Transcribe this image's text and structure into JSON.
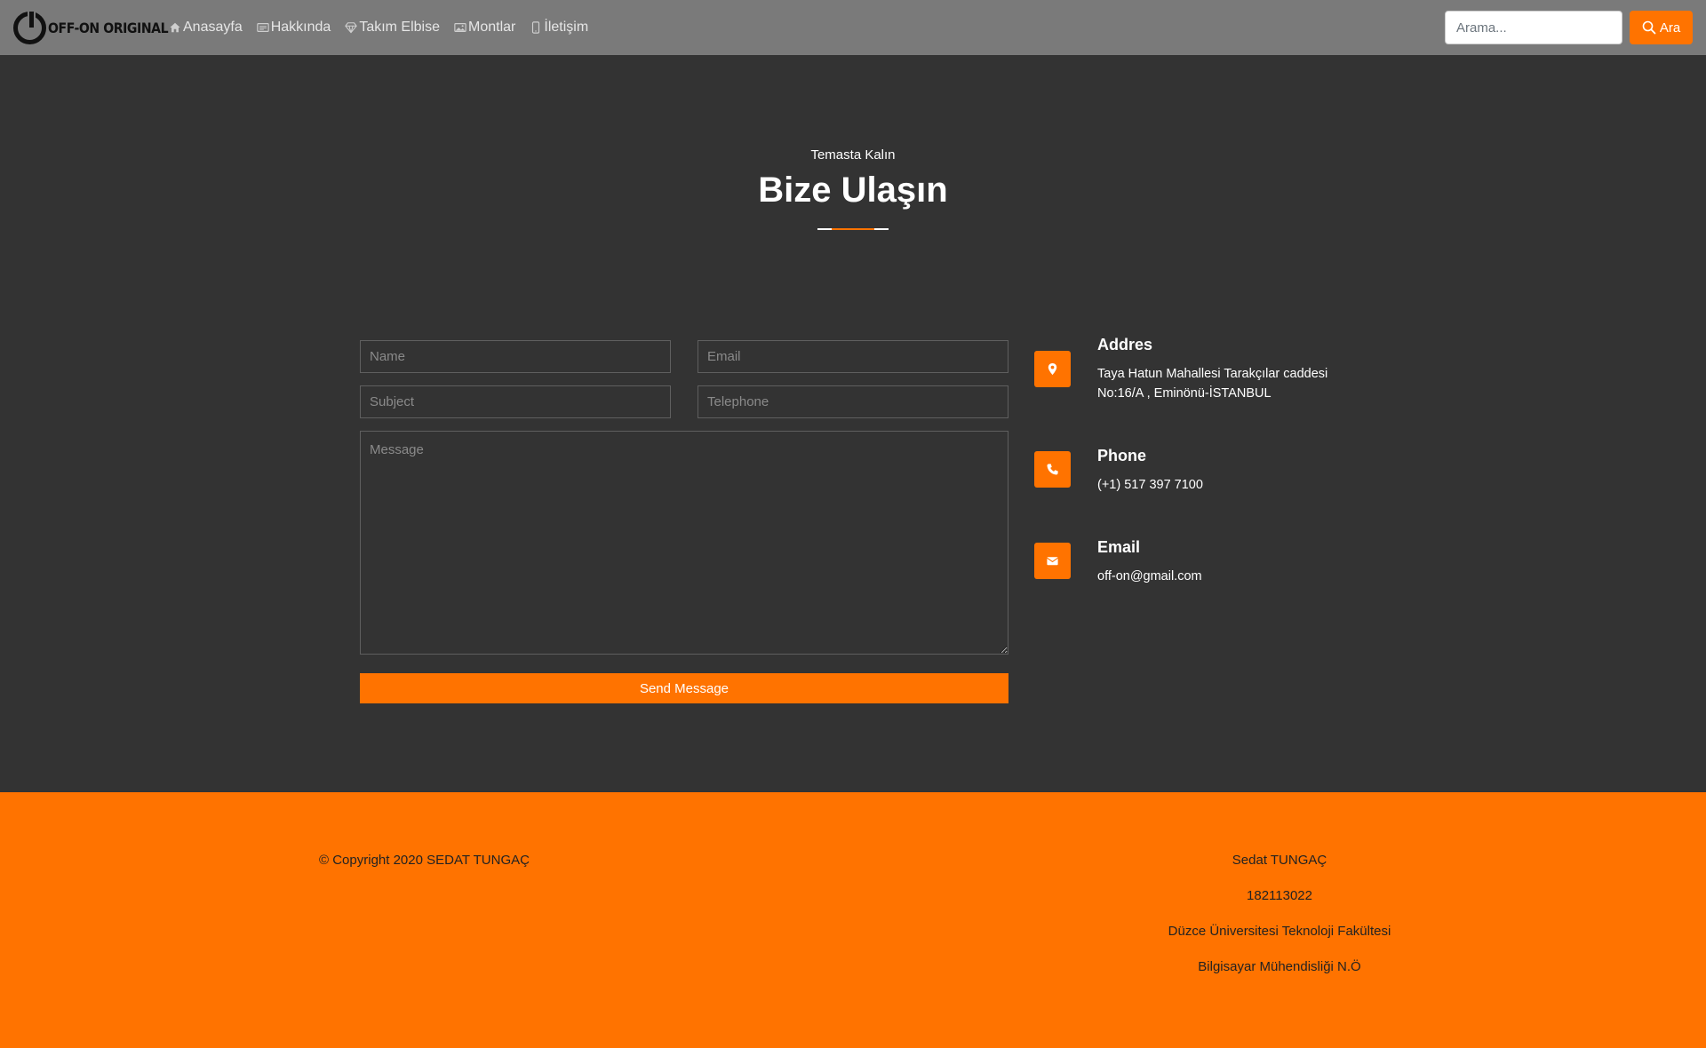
{
  "navbar": {
    "brand_text": "OFF-ON ORIGINAL",
    "items": [
      {
        "label": "Anasayfa",
        "icon": "home-icon"
      },
      {
        "label": "Hakkında",
        "icon": "card-text-icon"
      },
      {
        "label": "Takım Elbise",
        "icon": "gem-icon"
      },
      {
        "label": "Montlar",
        "icon": "image-icon"
      },
      {
        "label": "İletişim",
        "icon": "phone-icon"
      }
    ],
    "search_placeholder": "Arama...",
    "search_button": "Ara"
  },
  "header": {
    "subheading": "Temasta Kalın",
    "heading": "Bize Ulaşın"
  },
  "form": {
    "name_placeholder": "Name",
    "email_placeholder": "Email",
    "subject_placeholder": "Subject",
    "telephone_placeholder": "Telephone",
    "message_placeholder": "Message",
    "send_label": "Send Message"
  },
  "contact": {
    "address_title": "Addres",
    "address_line1": "Taya Hatun Mahallesi Tarakçılar caddesi",
    "address_line2": "No:16/A , Eminönü-İSTANBUL",
    "phone_title": "Phone",
    "phone_value": "(+1) 517 397 7100",
    "email_title": "Email",
    "email_value": "off-on@gmail.com"
  },
  "footer": {
    "copyright": "© Copyright 2020 SEDAT TUNGAÇ",
    "lines": [
      "Sedat TUNGAÇ",
      "182113022",
      "Düzce Üniversitesi Teknoloji Fakültesi",
      "Bilgisayar Mühendisliği N.Ö"
    ]
  },
  "colors": {
    "accent": "#ff7300",
    "navbar_bg": "#7a7a7a",
    "page_bg": "#333333"
  }
}
